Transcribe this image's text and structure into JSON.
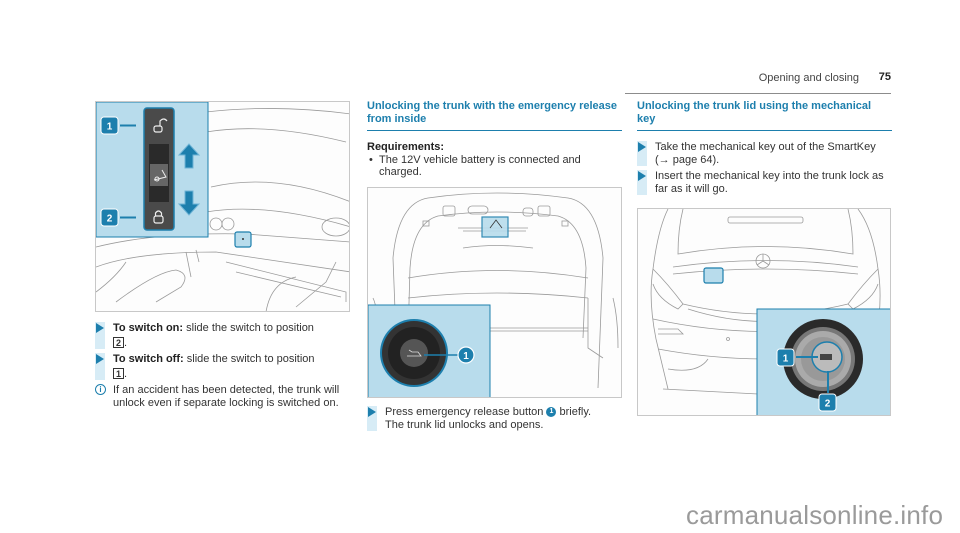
{
  "header": {
    "section": "Opening and closing",
    "page_number": "75"
  },
  "col1": {
    "figure": {
      "callouts": [
        "1",
        "2"
      ],
      "icons": [
        "unlock-icon",
        "trunk-open-icon",
        "lock-icon",
        "arrow-up-icon",
        "arrow-down-icon"
      ]
    },
    "steps": [
      {
        "bold": "To switch on:",
        "text": " slide the switch to position",
        "position": "2"
      },
      {
        "bold": "To switch off:",
        "text": " slide the switch to position",
        "position": "1"
      }
    ],
    "note": "If an accident has been detected, the trunk will unlock even if separate locking is switched on."
  },
  "col2": {
    "heading": "Unlocking the trunk with the emergency release from inside",
    "requirements_title": "Requirements:",
    "requirements": [
      "The 12V vehicle battery is connected and charged."
    ],
    "figure": {
      "callouts": [
        "1"
      ]
    },
    "steps": [
      {
        "text_before": "Press emergency release button",
        "badge": "1",
        "text_after": " briefly.",
        "result": "The trunk lid unlocks and opens."
      }
    ]
  },
  "col3": {
    "heading": "Unlocking the trunk lid using the mechanical key",
    "steps": [
      {
        "text": "Take the mechanical key out of the SmartKey (→ page 64)."
      },
      {
        "text": "Insert the mechanical key into the trunk lock as far as it will go."
      }
    ],
    "figure": {
      "callouts": [
        "1",
        "2"
      ]
    }
  },
  "watermark": "carmanualsonline.info",
  "colors": {
    "accent": "#1d7fad",
    "highlight": "#b8dcec",
    "step_bar": "#d7ecf6"
  }
}
